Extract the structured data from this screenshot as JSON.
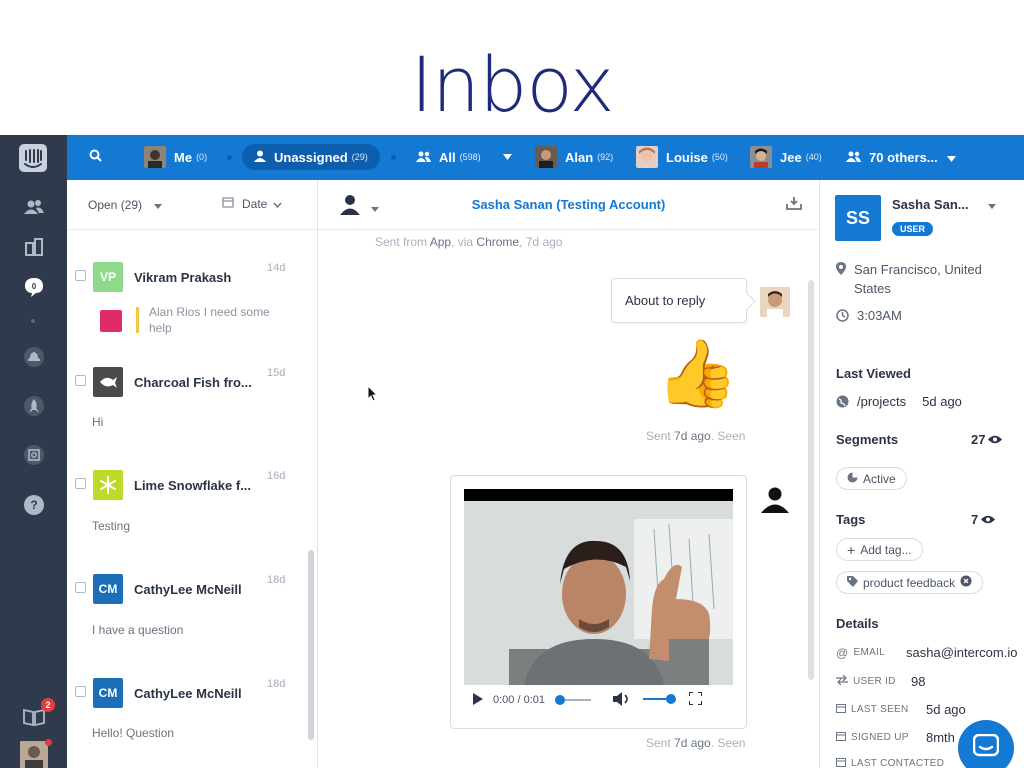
{
  "slide": {
    "title": "Inbox"
  },
  "topbar": {
    "search_icon": "search-icon",
    "me": {
      "label": "Me",
      "count": "(0)"
    },
    "unassigned": {
      "label": "Unassigned",
      "count": "(29)"
    },
    "all": {
      "label": "All",
      "count": "(598)"
    },
    "alan": {
      "label": "Alan",
      "count": "(92)"
    },
    "louise": {
      "label": "Louise",
      "count": "(50)"
    },
    "jee": {
      "label": "Jee",
      "count": "(40)"
    },
    "others": {
      "label": "70 others..."
    }
  },
  "rail": {
    "notification_count": "2"
  },
  "list": {
    "filter_status": "Open (29)",
    "sort": "Date",
    "conversations": [
      {
        "initials": "VP",
        "name": "Vikram Prakash",
        "age": "14d",
        "preview": "Alan Rios I need some help",
        "color": "#8fd98a"
      },
      {
        "initials": "",
        "name": "Charcoal Fish fro...",
        "age": "15d",
        "preview": "Hi",
        "color": "#4a4a4a"
      },
      {
        "initials": "",
        "name": "Lime Snowflake f...",
        "age": "16d",
        "preview": "Testing",
        "color": "#bfd92a"
      },
      {
        "initials": "CM",
        "name": "CathyLee McNeill",
        "age": "18d",
        "preview": "I have a question",
        "color": "#1479d2"
      },
      {
        "initials": "CM",
        "name": "CathyLee McNeill",
        "age": "18d",
        "preview": "Hello! Question",
        "color": "#1479d2"
      }
    ]
  },
  "chat": {
    "title": "Sasha Sanan (Testing Account)",
    "meta_top": {
      "prefix": "Sent from ",
      "app": "App",
      "mid": ", via ",
      "browser": "Chrome",
      "suffix": ", 7d ago"
    },
    "bubble_text": "About to reply",
    "emoji": "👍",
    "meta_mid": {
      "prefix": "Sent ",
      "when": "7d ago",
      "suffix": ". Seen"
    },
    "video_time": "0:00 / 0:01",
    "meta_bottom": {
      "prefix": "Sent ",
      "when": "7d ago",
      "suffix": ". Seen"
    }
  },
  "user": {
    "initials": "SS",
    "name": "Sasha San...",
    "badge": "USER",
    "location": "San Francisco, United States",
    "local_time": "3:03AM",
    "last_viewed_heading": "Last Viewed",
    "last_viewed_page": "/projects",
    "last_viewed_age": "5d ago",
    "segments_heading": "Segments",
    "segments_count": "27",
    "segment": "Active",
    "tags_heading": "Tags",
    "tags_count": "7",
    "add_tag": "Add tag...",
    "tag": "product feedback",
    "details_heading": "Details",
    "details": [
      {
        "key": "EMAIL",
        "value": "sasha@intercom.io"
      },
      {
        "key": "USER ID",
        "value": "98"
      },
      {
        "key": "LAST SEEN",
        "value": "5d ago"
      },
      {
        "key": "SIGNED UP",
        "value": "8mth"
      },
      {
        "key": "LAST CONTACTED",
        "value": ""
      }
    ]
  },
  "colors": {
    "brand": "#1479d2",
    "rail": "#2f3b4c",
    "title": "#1f2a7a"
  }
}
